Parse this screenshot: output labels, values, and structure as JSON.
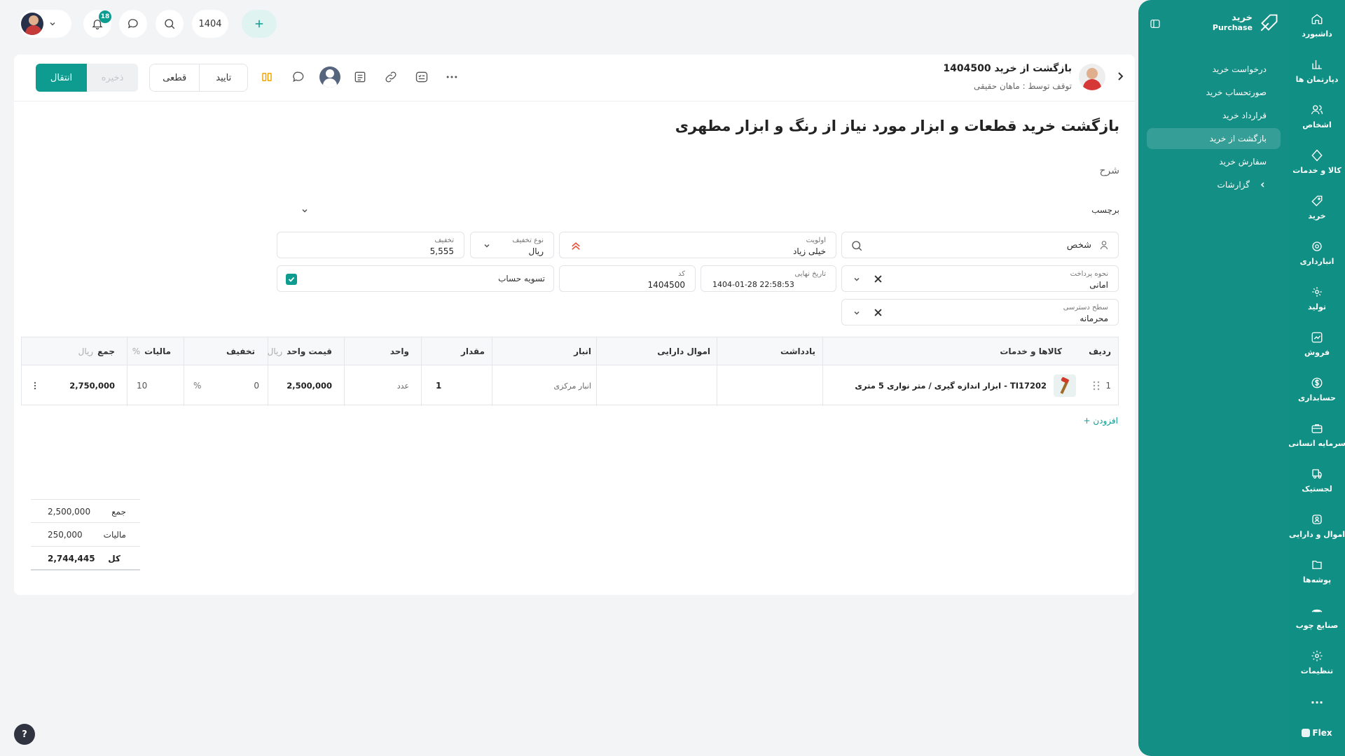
{
  "topbar": {
    "year": "1404",
    "notifications_count": "18"
  },
  "rail": {
    "items": [
      {
        "label": "داشبورد",
        "icon": "home-icon"
      },
      {
        "label": "دپارتمان ها",
        "icon": "chart-icon"
      },
      {
        "label": "اشخاص",
        "icon": "users-icon"
      },
      {
        "label": "کالا و خدمات",
        "icon": "box-icon"
      },
      {
        "label": "خرید",
        "icon": "tag-icon"
      },
      {
        "label": "انبارداری",
        "icon": "warehouse-icon"
      },
      {
        "label": "تولید",
        "icon": "factory-icon"
      },
      {
        "label": "فروش",
        "icon": "sales-icon"
      },
      {
        "label": "حسابداری",
        "icon": "dollar-icon"
      },
      {
        "label": "سرمایه انسانی",
        "icon": "briefcase-icon"
      },
      {
        "label": "لجستیک",
        "icon": "truck-icon"
      },
      {
        "label": "اموال و دارایی",
        "icon": "asset-icon"
      },
      {
        "label": "پوشه‌ها",
        "icon": "folder-icon"
      },
      {
        "label": "صنایع چوب",
        "icon": "wood-icon"
      },
      {
        "label": "تنظیمات",
        "icon": "settings-icon"
      }
    ],
    "more": "...",
    "brand": "Flex"
  },
  "submenu": {
    "title": "خرید",
    "subtitle": "Purchase",
    "items": [
      "درخواست خرید",
      "صورتحساب خرید",
      "قرارداد خرید",
      "بازگشت از خرید",
      "سفارش خرید"
    ],
    "reports": "گزارشات"
  },
  "header": {
    "title": "بازگشت از خرید 1404500",
    "subtitle": "توقف توسط : ماهان حقیقی",
    "btn_transfer": "انتقال",
    "btn_save": "ذخیره",
    "btn_final": "قطعی",
    "btn_confirm": "تایید"
  },
  "form": {
    "heading": "بازگشت خرید قطعات و ابزار مورد نیاز از  رنگ و ابزار مطهری",
    "description_label": "شرح",
    "tag_label": "برچسب",
    "person_label": "شخص",
    "priority_label": "اولویت",
    "priority_value": "خیلی زیاد",
    "discount_type_label": "نوع تخفیف",
    "discount_type_value": "ریال",
    "discount_label": "تخفیف",
    "discount_value": "5,555",
    "payment_method_label": "نحوه پرداخت",
    "payment_method_value": "امانی",
    "due_date_label": "تاریخ نهایی",
    "due_date_value": "1404-01-28 22:58:53",
    "code_label": "کد",
    "code_value": "1404500",
    "settlement_label": "تسویه حساب",
    "access_label": "سطح دسترسی",
    "access_value": "محرمانه"
  },
  "table": {
    "headers": {
      "row": "ردیف",
      "goods": "کالاها و خدمات",
      "note": "یادداشت",
      "asset": "اموال دارایی",
      "warehouse": "انبار",
      "qty": "مقدار",
      "unit": "واحد",
      "unit_price": "قیمت واحد",
      "unit_price_cur": "ریال",
      "discount": "تخفیف",
      "tax": "مالیات",
      "tax_unit": "%",
      "sum": "جمع",
      "sum_cur": "ریال"
    },
    "rows": [
      {
        "row": "1",
        "goods": "ابزار اندازه گیری / متر نواری 5 متری - TI17202",
        "note": "",
        "asset": "",
        "warehouse": "انبار مرکزی",
        "qty": "1",
        "unit": "عدد",
        "unit_price": "2,500,000",
        "discount": "0",
        "discount_unit": "%",
        "tax": "10",
        "sum": "2,750,000"
      }
    ],
    "add_label": "+ افزودن"
  },
  "totals": {
    "sum_label": "جمع",
    "sum_value": "2,500,000",
    "tax_label": "مالیات",
    "tax_value": "250,000",
    "total_label": "کل",
    "total_value": "2,744,445"
  },
  "help": "?",
  "colors": {
    "accent": "#0f9c90",
    "rail": "#108f84",
    "priority": "#e8553a"
  }
}
